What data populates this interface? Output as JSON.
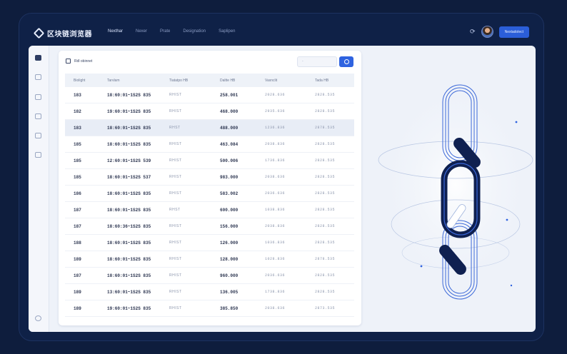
{
  "app": {
    "title": "区块链浏览器"
  },
  "nav": {
    "items": [
      "Nexthar",
      "Nexer",
      "Prate",
      "Designation",
      "Saplipen"
    ]
  },
  "header": {
    "cta_label": "Nextadolect"
  },
  "card": {
    "title": "Rdl obinnet",
    "search_placeholder": "-"
  },
  "table": {
    "columns": [
      "Biolight",
      "Tarvlam",
      "Tiatatpo HB",
      "Daltte HB",
      "Vaxnclit",
      "Tada HB"
    ],
    "rows": [
      [
        "183",
        "18:60:01~1S2S 835",
        "RHIST",
        "258.001",
        "2028.636",
        "2828.535"
      ],
      [
        "182",
        "19:60:01~1S2S 835",
        "RHIST",
        "468.000",
        "2935.636",
        "2828.535"
      ],
      [
        "183",
        "18:60:01~1S2S 835",
        "RHST",
        "488.000",
        "1236.836",
        "2878.535"
      ],
      [
        "185",
        "18:60:01~1S2S 835",
        "RHIST",
        "463.084",
        "2038.836",
        "2828.535"
      ],
      [
        "185",
        "12:60:01~1S2S 539",
        "RHIST",
        "500.006",
        "1736.836",
        "2828.535"
      ],
      [
        "185",
        "18:60:01~1S2S 537",
        "RHIST",
        "983.000",
        "2038.636",
        "2828.535"
      ],
      [
        "186",
        "18:60:01~1S2S 835",
        "RHIST",
        "583.002",
        "2036.636",
        "2828.535"
      ],
      [
        "187",
        "18:60:01~1S2S 835",
        "RHST",
        "600.000",
        "1038.836",
        "2828.535"
      ],
      [
        "187",
        "18:60:36~1S2S 835",
        "RHIST",
        "156.000",
        "2038.836",
        "2828.535"
      ],
      [
        "188",
        "18:60:01~1S2S 835",
        "RHIST",
        "126.000",
        "1036.836",
        "2828.535"
      ],
      [
        "189",
        "18:60:01~1S2S 835",
        "RHIST",
        "128.000",
        "1028.836",
        "2878.535"
      ],
      [
        "187",
        "18:60:01~1S2S 835",
        "RHIST",
        "960.000",
        "2036.636",
        "2828.535"
      ],
      [
        "189",
        "13:60:01~1S2S 835",
        "RHIST",
        "136.005",
        "1738.836",
        "2828.535"
      ],
      [
        "189",
        "19:60:01~1S2S 835",
        "RHIST",
        "385.850",
        "2038.636",
        "2873.535"
      ]
    ]
  },
  "colors": {
    "accent": "#2f63e0",
    "frame": "#0f2147",
    "surface": "#eef2f9",
    "chain_dark": "#0f2050"
  }
}
